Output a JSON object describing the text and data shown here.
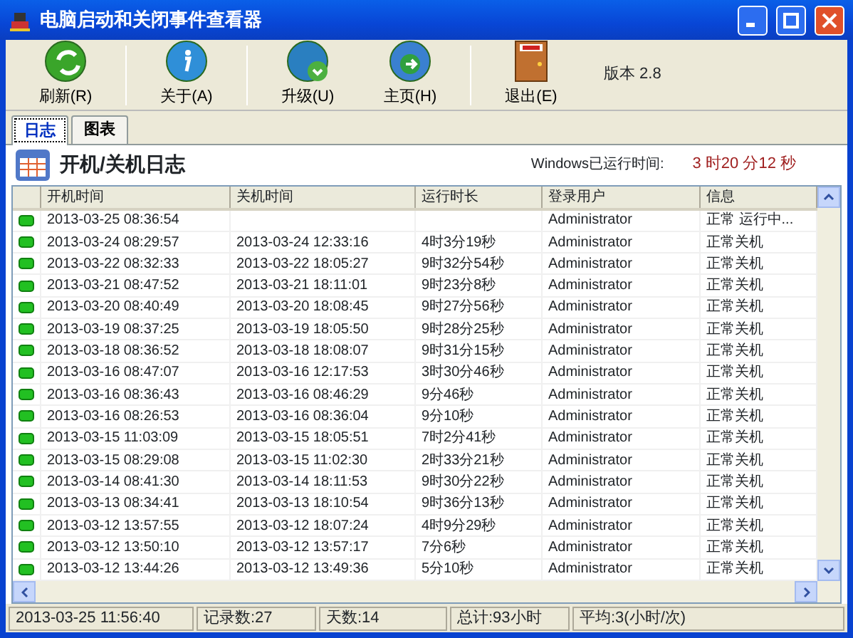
{
  "window": {
    "title": "电脑启动和关闭事件查看器"
  },
  "toolbar": {
    "buttons": [
      {
        "label": "刷新(R)",
        "kind": "refresh"
      },
      {
        "label": "关于(A)",
        "kind": "about"
      },
      {
        "label": "升级(U)",
        "kind": "upgrade"
      },
      {
        "label": "主页(H)",
        "kind": "home"
      },
      {
        "label": "退出(E)",
        "kind": "exit"
      }
    ],
    "version": "版本 2.8"
  },
  "tabs": [
    {
      "label": "日志",
      "selected": true
    },
    {
      "label": "图表",
      "selected": false
    }
  ],
  "header": {
    "title": "开机/关机日志",
    "uptime_label": "Windows已运行时间:",
    "uptime_value": "3 时20 分12 秒"
  },
  "table": {
    "columns": [
      "开机时间",
      "关机时间",
      "运行时长",
      "登录用户",
      "信息"
    ],
    "rows": [
      [
        "2013-03-25 08:36:54",
        "",
        "",
        "Administrator",
        "正常 运行中..."
      ],
      [
        "2013-03-24 08:29:57",
        "2013-03-24 12:33:16",
        "4时3分19秒",
        "Administrator",
        "正常关机"
      ],
      [
        "2013-03-22 08:32:33",
        "2013-03-22 18:05:27",
        "9时32分54秒",
        "Administrator",
        "正常关机"
      ],
      [
        "2013-03-21 08:47:52",
        "2013-03-21 18:11:01",
        "9时23分8秒",
        "Administrator",
        "正常关机"
      ],
      [
        "2013-03-20 08:40:49",
        "2013-03-20 18:08:45",
        "9时27分56秒",
        "Administrator",
        "正常关机"
      ],
      [
        "2013-03-19 08:37:25",
        "2013-03-19 18:05:50",
        "9时28分25秒",
        "Administrator",
        "正常关机"
      ],
      [
        "2013-03-18 08:36:52",
        "2013-03-18 18:08:07",
        "9时31分15秒",
        "Administrator",
        "正常关机"
      ],
      [
        "2013-03-16 08:47:07",
        "2013-03-16 12:17:53",
        "3时30分46秒",
        "Administrator",
        "正常关机"
      ],
      [
        "2013-03-16 08:36:43",
        "2013-03-16 08:46:29",
        "9分46秒",
        "Administrator",
        "正常关机"
      ],
      [
        "2013-03-16 08:26:53",
        "2013-03-16 08:36:04",
        "9分10秒",
        "Administrator",
        "正常关机"
      ],
      [
        "2013-03-15 11:03:09",
        "2013-03-15 18:05:51",
        "7时2分41秒",
        "Administrator",
        "正常关机"
      ],
      [
        "2013-03-15 08:29:08",
        "2013-03-15 11:02:30",
        "2时33分21秒",
        "Administrator",
        "正常关机"
      ],
      [
        "2013-03-14 08:41:30",
        "2013-03-14 18:11:53",
        "9时30分22秒",
        "Administrator",
        "正常关机"
      ],
      [
        "2013-03-13 08:34:41",
        "2013-03-13 18:10:54",
        "9时36分13秒",
        "Administrator",
        "正常关机"
      ],
      [
        "2013-03-12 13:57:55",
        "2013-03-12 18:07:24",
        "4时9分29秒",
        "Administrator",
        "正常关机"
      ],
      [
        "2013-03-12 13:50:10",
        "2013-03-12 13:57:17",
        "7分6秒",
        "Administrator",
        "正常关机"
      ],
      [
        "2013-03-12 13:44:26",
        "2013-03-12 13:49:36",
        "5分10秒",
        "Administrator",
        "正常关机"
      ]
    ]
  },
  "status_bar": [
    "2013-03-25 11:56:40",
    "记录数:27",
    "天数:14",
    "总计:93小时",
    "平均:3(小时/次)"
  ]
}
